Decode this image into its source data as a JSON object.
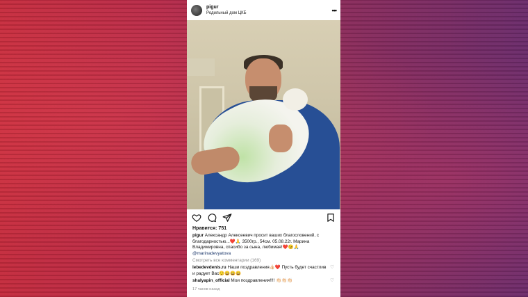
{
  "post": {
    "username": "pigur",
    "location": "Родильный дом ЦКБ",
    "more_label": "•••",
    "likes_label": "Нравится: 751",
    "caption_user": "pigur",
    "caption_text": "Александр Алексеевич просит ваших благословений, с благодарностью...❤️🙏 3500гр., 54см. 05.08.22г. Марина Владимировна, спасибо за сына, любимая!❤️😉🙏",
    "caption_mention": "@marinadevyatova",
    "view_comments": "Смотреть все комментарии (169)",
    "comments": [
      {
        "user": "lebedevdenis.ru",
        "text": "Наши поздравления👍🏻❤️ Пусть будет счастлив и радует Вас😌😄😄😄"
      },
      {
        "user": "shalyapin_official",
        "text": "Мои поздравления!!!! 👏🏻👏🏻👏🏻"
      }
    ],
    "time_ago": "17 часов назад"
  },
  "icons": {
    "like": "heart-icon",
    "comment": "comment-icon",
    "share": "paper-plane-icon",
    "save": "bookmark-icon"
  }
}
